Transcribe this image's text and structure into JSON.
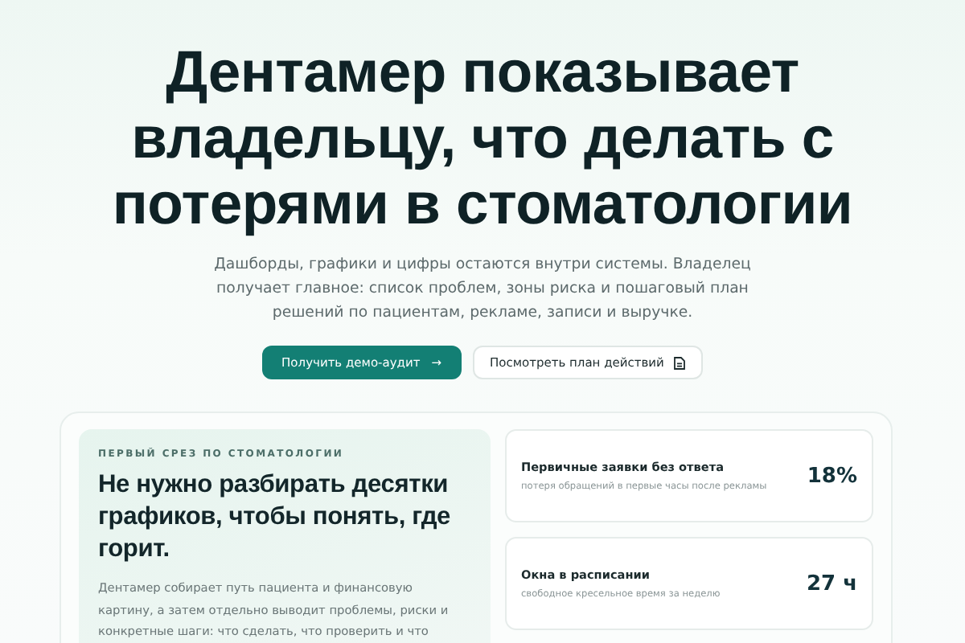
{
  "hero": {
    "title": "Дентамер показывает владельцу, что делать с потерями в стоматологии",
    "subtitle": "Дашборды, графики и цифры остаются внутри системы. Владелец получает главное: список проблем, зоны риска и пошаговый план решений по пациентам, рекламе, записи и выручке.",
    "primary_button": "Получить демо-аудит",
    "primary_icon": "→",
    "secondary_button": "Посмотреть план действий"
  },
  "panel": {
    "eyebrow": "ПЕРВЫЙ СРЕЗ ПО СТОМАТОЛОГИИ",
    "heading": "Не нужно разбирать десятки графиков, чтобы понять, где горит.",
    "text": "Дентамер собирает путь пациента и финансовую картину, а затем отдельно выводит проблемы, риски и конкретные шаги: что сделать, что проверить и что"
  },
  "metrics": [
    {
      "title": "Первичные заявки без ответа",
      "note": "потеря обращений в первые часы после рекламы",
      "value": "18%"
    },
    {
      "title": "Окна в расписании",
      "note": "свободное кресельное время за неделю",
      "value": "27 ч"
    }
  ]
}
